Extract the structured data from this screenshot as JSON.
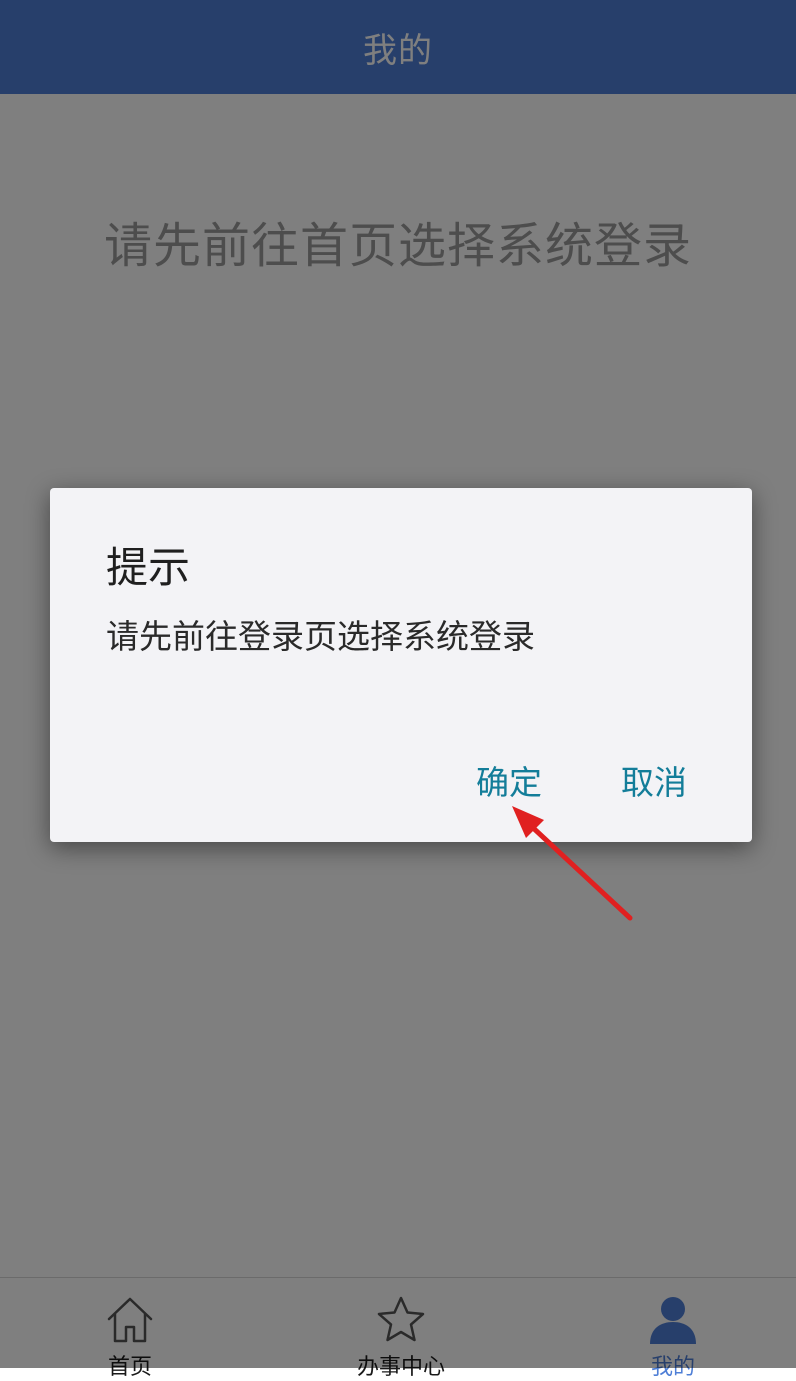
{
  "header": {
    "title": "我的"
  },
  "main": {
    "message": "请先前往首页选择系统登录"
  },
  "dialog": {
    "title": "提示",
    "message": "请先前往登录页选择系统登录",
    "confirm_label": "确定",
    "cancel_label": "取消"
  },
  "tabbar": {
    "tabs": [
      {
        "label": "首页",
        "icon": "home-icon",
        "active": false
      },
      {
        "label": "办事中心",
        "icon": "star-icon",
        "active": false
      },
      {
        "label": "我的",
        "icon": "user-icon",
        "active": true
      }
    ]
  },
  "colors": {
    "brand": "#4f7fd6",
    "dialog_button": "#137d99",
    "annotation_arrow": "#e02020"
  }
}
